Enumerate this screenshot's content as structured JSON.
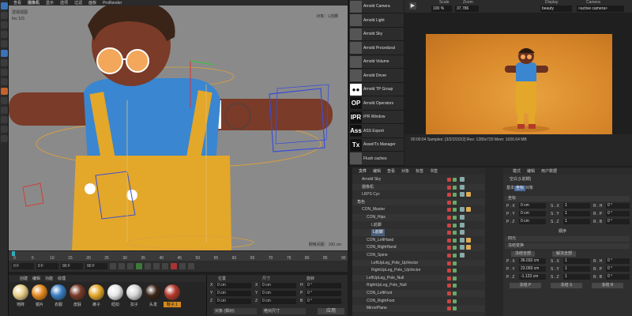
{
  "viewport": {
    "menu": [
      "查看",
      "摄像机",
      "显示",
      "选项",
      "过滤",
      "面板",
      "ProRender"
    ],
    "active_menu_index": 1,
    "label": "透视视图",
    "fov_label": "fov",
    "fov_value": "115",
    "target_label": "对象：L前脚",
    "grid_label": "网格间距：100 cm"
  },
  "timeline": {
    "ticks": [
      "0",
      "5",
      "10",
      "15",
      "20",
      "25",
      "30",
      "35",
      "40",
      "45",
      "50",
      "55",
      "60",
      "65",
      "70",
      "75",
      "80",
      "85",
      "90"
    ],
    "current_frame": "0 F",
    "start_frame": "0 F",
    "end_frame": "90 F",
    "end_frame2": "90 F"
  },
  "material_manager": {
    "menu": [
      "创建",
      "编辑",
      "功能",
      "纹理"
    ],
    "materials": [
      {
        "label": "地砖",
        "color": "#e8d08a"
      },
      {
        "label": "镜片",
        "color": "#e58a20"
      },
      {
        "label": "衣服",
        "color": "#3a7ec4"
      },
      {
        "label": "皮肤",
        "color": "#7a3b28"
      },
      {
        "label": "裤子",
        "color": "#e3a72a"
      },
      {
        "label": "纽扣",
        "color": "#e8e8e8"
      },
      {
        "label": "扣子",
        "color": "#d7d7d7"
      },
      {
        "label": "头发",
        "color": "#3a2418"
      },
      {
        "label": "鞋子.1",
        "color": "#b33a2a"
      }
    ],
    "selected_index": 8
  },
  "coordinates": {
    "headers": [
      "位置",
      "尺寸",
      "旋转"
    ],
    "rows": [
      {
        "axis": "X",
        "pos": "0 cm",
        "size_axis": "X",
        "size": "0 cm",
        "rot_axis": "H",
        "rot": "0 °"
      },
      {
        "axis": "Y",
        "pos": "0 cm",
        "size_axis": "Y",
        "size": "0 cm",
        "rot_axis": "P",
        "rot": "0 °"
      },
      {
        "axis": "Z",
        "pos": "0 cm",
        "size_axis": "Z",
        "size": "0 cm",
        "rot_axis": "B",
        "rot": "0 °"
      }
    ],
    "mode": "对象 (相对)",
    "size_mode": "绝对尺寸",
    "apply": "应用"
  },
  "arnold_shelf": [
    {
      "icon": "cam",
      "label": "Arnold Camera"
    },
    {
      "icon": "light",
      "label": "Arnold Light"
    },
    {
      "icon": "sky",
      "label": "Arnold Sky"
    },
    {
      "icon": "proc",
      "label": "Arnold Procedural"
    },
    {
      "icon": "vol",
      "label": "Arnold Volume"
    },
    {
      "icon": "drv",
      "label": "Arnold Driver"
    },
    {
      "icon": "grp",
      "label": "Arnold TP Group"
    },
    {
      "icon": "OP",
      "label": "Arnold Operators"
    },
    {
      "icon": "IPR",
      "label": "IPR Window"
    },
    {
      "icon": "Ass",
      "label": "ASS Export"
    },
    {
      "icon": "Tx",
      "label": "Asset/Tx Manager"
    },
    {
      "icon": "flush",
      "label": "Flush caches"
    }
  ],
  "render_view": {
    "scale_label": "Scale",
    "scale_value": "100 %",
    "zoom_label": "Zoom",
    "zoom_value": "37.786",
    "display_label": "Display",
    "display_value": "beauty",
    "camera_label": "Camera",
    "camera_value": "<active camera>",
    "status": "00:00:04  Samples: [3/2/2/2/2/2]  Res: 1280x720  Mem: 1026.64 MB"
  },
  "object_manager": {
    "menu": [
      "文件",
      "编辑",
      "查看",
      "对象",
      "标签",
      "书签"
    ],
    "active_menu_index": 0,
    "rows": [
      {
        "name": "Arnold Sky",
        "indent": 1
      },
      {
        "name": "摄像机",
        "indent": 1
      },
      {
        "name": "LKPS Cyc",
        "indent": 1
      },
      {
        "name": "角色",
        "indent": 0
      },
      {
        "name": "CON_Master",
        "indent": 1
      },
      {
        "name": "CON_Hips",
        "indent": 2
      },
      {
        "name": "L前脚",
        "indent": 3
      },
      {
        "name": "L前脚",
        "indent": 3,
        "selected": true
      },
      {
        "name": "CON_LeftHand",
        "indent": 2
      },
      {
        "name": "CON_RightHand",
        "indent": 2
      },
      {
        "name": "CON_Spine",
        "indent": 2
      },
      {
        "name": "LeftUpLeg_Pole_UpVector",
        "indent": 3
      },
      {
        "name": "RightUpLeg_Pole_UpVector",
        "indent": 3
      },
      {
        "name": "LeftUpLeg_Pole_Null",
        "indent": 2
      },
      {
        "name": "RightUpLeg_Pole_Null",
        "indent": 2
      },
      {
        "name": "CON_LeftFoot",
        "indent": 2
      },
      {
        "name": "CON_RightFoot",
        "indent": 2
      },
      {
        "name": "MirrorPlane",
        "indent": 2
      }
    ]
  },
  "attribute_manager": {
    "menu": [
      "模式",
      "编辑",
      "用户数据"
    ],
    "title": "空白 [L前脚]",
    "tabs": [
      "基本",
      "坐标",
      "对象"
    ],
    "active_tab": 1,
    "section_coord": "坐标",
    "coord_rows": [
      {
        "p": "P . X",
        "pv": "0 cm",
        "s": "S . X",
        "sv": "1",
        "r": "R . H",
        "rv": "0 °"
      },
      {
        "p": "P . Y",
        "pv": "0 cm",
        "s": "S . Y",
        "sv": "1",
        "r": "R . P",
        "rv": "0 °"
      },
      {
        "p": "P . Z",
        "pv": "0 cm",
        "s": "S . Z",
        "sv": "1",
        "r": "R . B",
        "rv": "0 °"
      }
    ],
    "order_label": "顺序",
    "section_quat": "四元",
    "section_freeze": "冻结变换",
    "freeze_all": "冻结全部",
    "unfreeze_all": "解冻全部",
    "freeze_rows": [
      {
        "p": "P . X",
        "pv": "36.032 cm",
        "s": "S . X",
        "sv": "1",
        "r": "R . H",
        "rv": "0 °"
      },
      {
        "p": "P . Y",
        "pv": "23.093 cm",
        "s": "S . Y",
        "sv": "1",
        "r": "R . P",
        "rv": "0 °"
      },
      {
        "p": "P . Z",
        "pv": "-1.123 cm",
        "s": "S . Z",
        "sv": "1",
        "r": "R . B",
        "rv": "0 °"
      }
    ],
    "freeze_p": "冻结 P",
    "freeze_s": "冻结 S",
    "freeze_r": "冻结 R"
  }
}
